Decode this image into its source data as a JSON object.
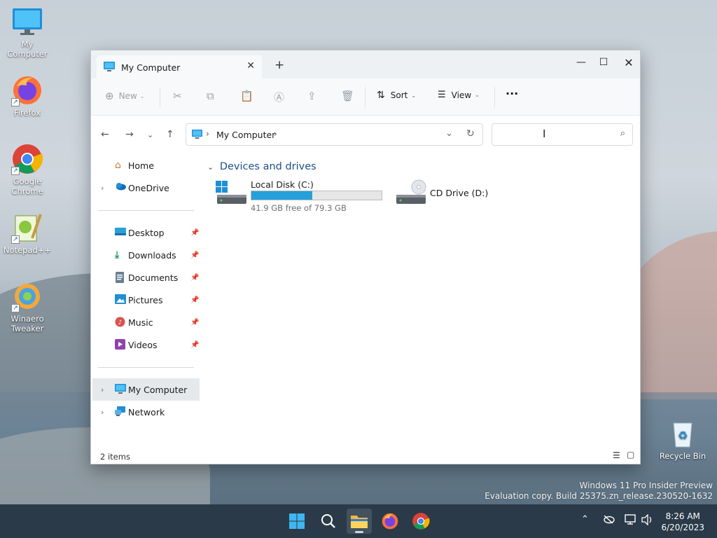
{
  "desktop": {
    "icons": [
      {
        "label": "My Computer"
      },
      {
        "label": "Firefox"
      },
      {
        "label": "Google Chrome"
      },
      {
        "label": "Notepad++"
      },
      {
        "label": "Winaero Tweaker"
      },
      {
        "label": "Recycle Bin"
      }
    ],
    "watermark": {
      "line1": "Windows 11 Pro Insider Preview",
      "line2": "Evaluation copy. Build 25375.zn_release.230520-1632"
    }
  },
  "window": {
    "tab_title": "My Computer",
    "new_tab": "+",
    "controls": {
      "minimize": "—",
      "maximize": "☐",
      "close": "✕"
    }
  },
  "toolbar": {
    "new_label": "New",
    "sort_label": "Sort",
    "view_label": "View",
    "more_label": "···"
  },
  "address": {
    "path": "My Computer",
    "search_placeholder": ""
  },
  "sidebar": {
    "home": "Home",
    "onedrive": "OneDrive",
    "quick_access": [
      {
        "label": "Desktop"
      },
      {
        "label": "Downloads"
      },
      {
        "label": "Documents"
      },
      {
        "label": "Pictures"
      },
      {
        "label": "Music"
      },
      {
        "label": "Videos"
      }
    ],
    "my_computer": "My Computer",
    "network": "Network"
  },
  "content": {
    "group_header": "Devices and drives",
    "drives": [
      {
        "name": "Local Disk (C:)",
        "free_text": "41.9 GB free of 79.3 GB",
        "used_fraction": 0.47
      },
      {
        "name": "CD Drive (D:)"
      }
    ]
  },
  "status": {
    "items_count": "2 items"
  },
  "taskbar": {
    "time": "8:26 AM",
    "date": "6/20/2023"
  },
  "colors": {
    "accent": "#26a0da",
    "taskbar": "#2b3a48",
    "header_text": "#1f4e8c"
  }
}
